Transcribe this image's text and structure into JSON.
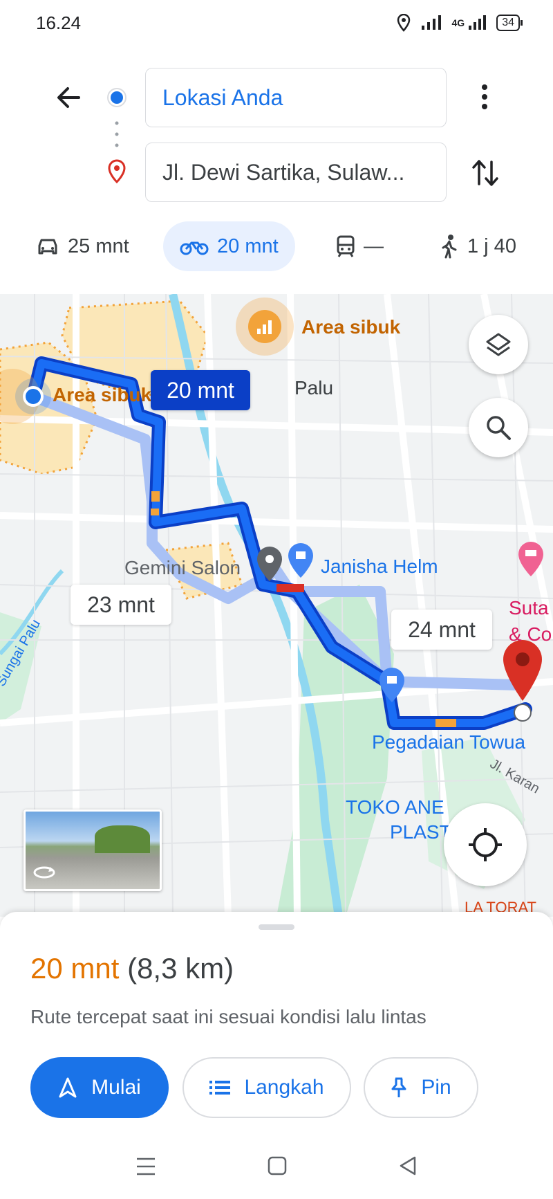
{
  "status_bar": {
    "time": "16.24",
    "battery": "34",
    "network": "4G"
  },
  "search": {
    "origin": "Lokasi Anda",
    "destination": "Jl. Dewi Sartika, Sulaw..."
  },
  "modes": [
    {
      "icon": "car-icon",
      "label": "25 mnt"
    },
    {
      "icon": "motorcycle-icon",
      "label": "20 mnt",
      "active": true
    },
    {
      "icon": "transit-icon",
      "label": "—"
    },
    {
      "icon": "walk-icon",
      "label": "1 j 40"
    }
  ],
  "map": {
    "labels": {
      "busy_area_1": "Area sibuk",
      "busy_area_2": "Area sibuk",
      "city": "Palu",
      "place_salon": "Gemini Salon",
      "place_helm": "Janisha Helm",
      "place_pegadaian": "Pegadaian Towua",
      "place_toko_1": "TOKO ANE",
      "place_toko_2": "PLAST",
      "place_suta_1": "Suta",
      "place_suta_2": "& Co",
      "river": "Sungai Palu",
      "street": "Jl. Karan",
      "partial_label": "LA TORAT"
    },
    "route_labels": {
      "selected": "20 mnt",
      "alt1": "23 mnt",
      "alt2": "24 mnt"
    },
    "colors": {
      "route": "#1a4ee6",
      "alt_route": "#a9c1f5",
      "busy": "#f2a33a",
      "destination": "#d93025"
    }
  },
  "route_summary": {
    "duration": "20 mnt",
    "distance": "(8,3 km)",
    "description": "Rute tercepat saat ini sesuai kondisi lalu lintas"
  },
  "actions": {
    "start": "Mulai",
    "steps": "Langkah",
    "pin": "Pin"
  }
}
